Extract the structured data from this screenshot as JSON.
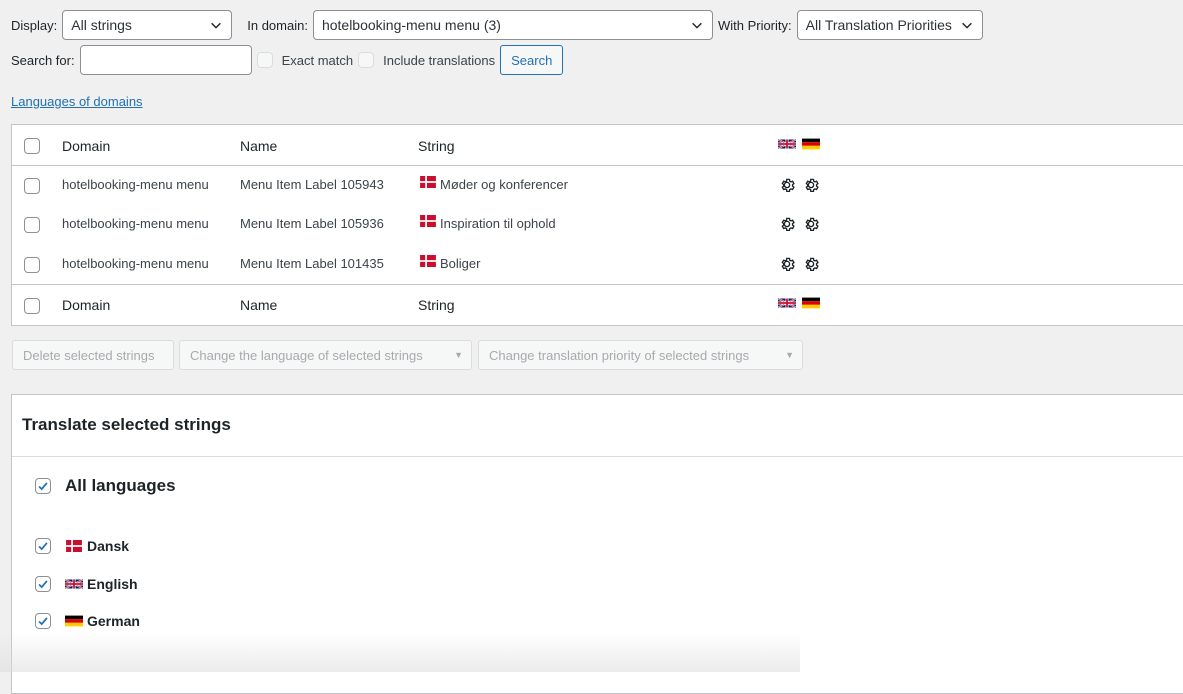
{
  "filters": {
    "display_label": "Display:",
    "display_value": "All strings",
    "domain_label": "In domain:",
    "domain_value": "hotelbooking-menu menu (3)",
    "priority_label": "With Priority:",
    "priority_value": "All Translation Priorities",
    "search_label": "Search for:",
    "search_value": "",
    "exact_match_label": "Exact match",
    "include_translations_label": "Include translations",
    "search_button": "Search"
  },
  "languages_link": "Languages of domains",
  "table": {
    "headers": {
      "domain": "Domain",
      "name": "Name",
      "string": "String"
    },
    "rows": [
      {
        "domain": "hotelbooking-menu menu",
        "name": "Menu Item Label 105943",
        "string": "Møder og konferencer"
      },
      {
        "domain": "hotelbooking-menu menu",
        "name": "Menu Item Label 105936",
        "string": "Inspiration til ophold"
      },
      {
        "domain": "hotelbooking-menu menu",
        "name": "Menu Item Label 101435",
        "string": "Boliger"
      }
    ]
  },
  "bulk_actions": {
    "delete": "Delete selected strings",
    "change_language": "Change the language of selected strings",
    "change_priority": "Change translation priority of selected strings"
  },
  "translate_panel": {
    "title": "Translate selected strings",
    "all_languages": "All languages",
    "languages": [
      {
        "name": "Dansk",
        "flag": "flag-dk"
      },
      {
        "name": "English",
        "flag": "flag-uk"
      },
      {
        "name": "German",
        "flag": "flag-de"
      }
    ]
  },
  "colors": {
    "accent": "#2271b1",
    "background": "#f0f0f1",
    "panel": "#ffffff"
  }
}
